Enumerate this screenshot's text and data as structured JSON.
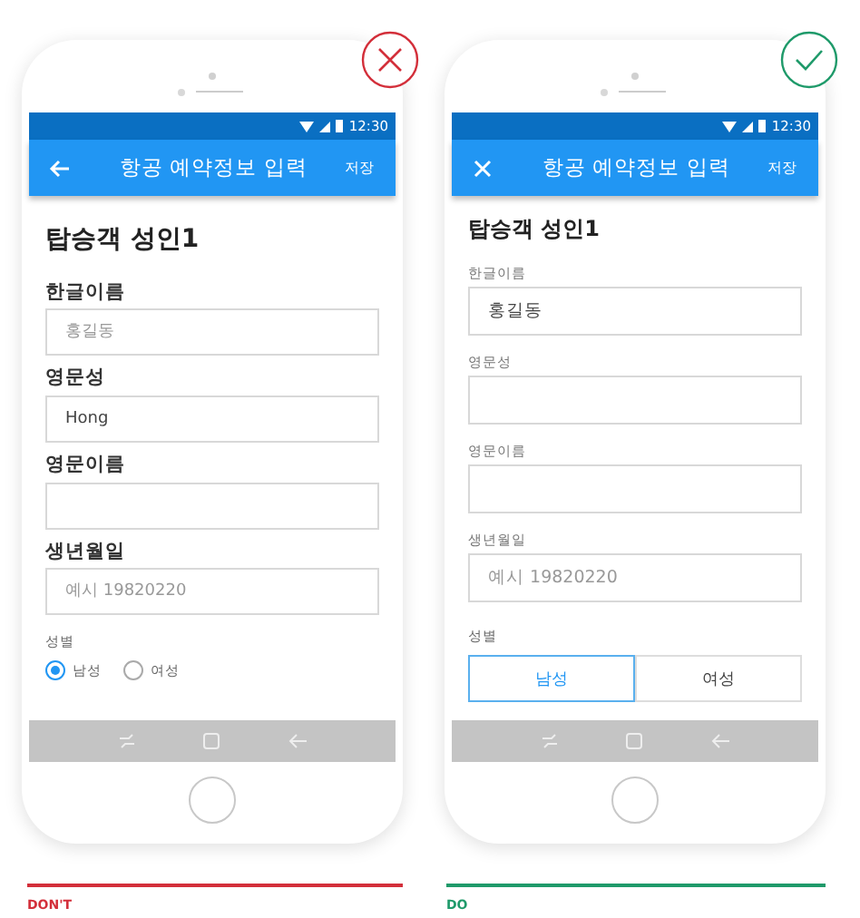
{
  "panels": [
    {
      "kind": "dont",
      "caption": "DON'T",
      "phone": {
        "status_time": "12:30",
        "app_bar": {
          "nav": {
            "kind": "back"
          },
          "title": "항공 예약정보 입력",
          "action": "저장"
        },
        "heading": "탑승객 성인1",
        "label": {
          "kind": "bold"
        },
        "fields": [
          {
            "label": "한글이름",
            "placeholder": "홍길동"
          },
          {
            "label": "영문성",
            "value": "Hong"
          },
          {
            "label": "영문이름"
          },
          {
            "label": "생년월일",
            "placeholder": "예시 19820220"
          }
        ],
        "gender": {
          "label": "성별",
          "kind": "radio",
          "options": [
            {
              "label": "남성",
              "selected": true
            },
            {
              "label": "여성",
              "selected": false
            }
          ]
        }
      }
    },
    {
      "kind": "do",
      "caption": "DO",
      "phone": {
        "status_time": "12:30",
        "app_bar": {
          "nav": {
            "kind": "close"
          },
          "title": "항공 예약정보 입력",
          "action": "저장"
        },
        "heading": "탑승객 성인1",
        "label": {
          "kind": "small"
        },
        "fields": [
          {
            "label": "한글이름",
            "value": "홍길동"
          },
          {
            "label": "영문성"
          },
          {
            "label": "영문이름"
          },
          {
            "label": "생년월일",
            "placeholder": "예시 19820220"
          }
        ],
        "gender": {
          "label": "성별",
          "kind": "segmented",
          "options": [
            {
              "label": "남성",
              "selected": true
            },
            {
              "label": "여성",
              "selected": false
            }
          ]
        }
      }
    }
  ]
}
